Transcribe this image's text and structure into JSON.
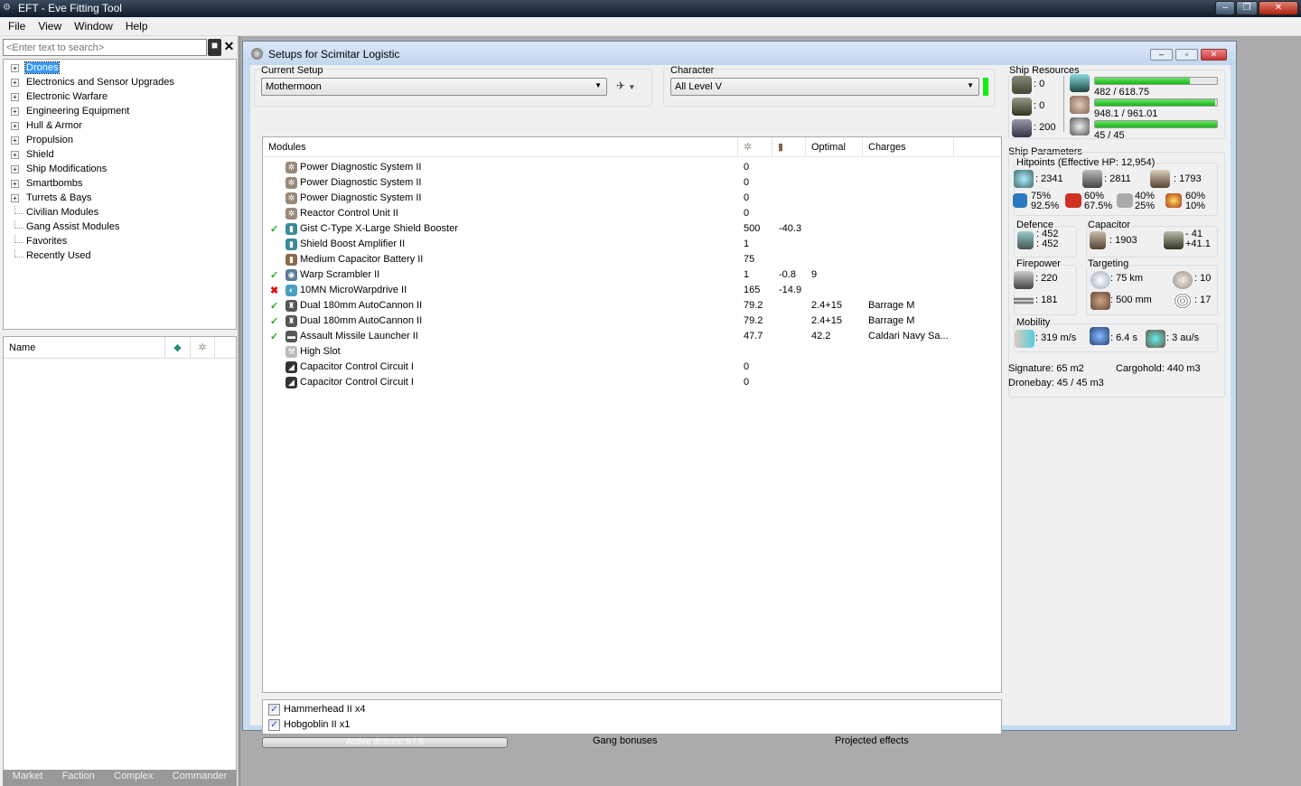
{
  "window": {
    "title": "EFT - Eve Fitting Tool",
    "min": "–",
    "max": "❐",
    "close": "✕"
  },
  "menu": [
    "File",
    "View",
    "Window",
    "Help"
  ],
  "search": {
    "placeholder": "<Enter text to search>"
  },
  "tree": [
    {
      "label": "Drones",
      "expandable": true,
      "selected": true
    },
    {
      "label": "Electronics and Sensor Upgrades",
      "expandable": true
    },
    {
      "label": "Electronic Warfare",
      "expandable": true
    },
    {
      "label": "Engineering Equipment",
      "expandable": true
    },
    {
      "label": "Hull & Armor",
      "expandable": true
    },
    {
      "label": "Propulsion",
      "expandable": true
    },
    {
      "label": "Shield",
      "expandable": true
    },
    {
      "label": "Ship Modifications",
      "expandable": true
    },
    {
      "label": "Smartbombs",
      "expandable": true
    },
    {
      "label": "Turrets & Bays",
      "expandable": true
    },
    {
      "label": "Civilian Modules",
      "expandable": false
    },
    {
      "label": "Gang Assist Modules",
      "expandable": false
    },
    {
      "label": "Favorites",
      "expandable": false
    },
    {
      "label": "Recently Used",
      "expandable": false
    }
  ],
  "namelist": {
    "header": "Name"
  },
  "bottom_tabs": [
    "Market",
    "Faction",
    "Complex",
    "Commander"
  ],
  "setup": {
    "title": "Setups for Scimitar Logistic",
    "current_setup_label": "Current Setup",
    "current_setup": "Mothermoon",
    "character_label": "Character",
    "character": "All Level V",
    "columns": {
      "modules": "Modules",
      "optimal": "Optimal",
      "charges": "Charges"
    },
    "modules": [
      {
        "state": "",
        "icon": "cpu",
        "color": "#9a8a7a",
        "name": "Power Diagnostic System II",
        "cpu": "0",
        "cap": "",
        "optimal": "",
        "charges": ""
      },
      {
        "state": "",
        "icon": "cpu",
        "color": "#9a8a7a",
        "name": "Power Diagnostic System II",
        "cpu": "0",
        "cap": "",
        "optimal": "",
        "charges": ""
      },
      {
        "state": "",
        "icon": "cpu",
        "color": "#9a8a7a",
        "name": "Power Diagnostic System II",
        "cpu": "0",
        "cap": "",
        "optimal": "",
        "charges": ""
      },
      {
        "state": "",
        "icon": "cpu",
        "color": "#9a8a7a",
        "name": "Reactor Control Unit II",
        "cpu": "0",
        "cap": "",
        "optimal": "",
        "charges": ""
      },
      {
        "state": "on",
        "icon": "shield",
        "color": "#3a8a9a",
        "name": "Gist C-Type X-Large Shield Booster",
        "cpu": "500",
        "cap": "-40.3",
        "optimal": "",
        "charges": ""
      },
      {
        "state": "",
        "icon": "shield",
        "color": "#3a8a9a",
        "name": "Shield Boost Amplifier II",
        "cpu": "1",
        "cap": "",
        "optimal": "",
        "charges": ""
      },
      {
        "state": "",
        "icon": "battery",
        "color": "#8a6a4a",
        "name": "Medium Capacitor Battery II",
        "cpu": "75",
        "cap": "",
        "optimal": "",
        "charges": ""
      },
      {
        "state": "on",
        "icon": "scrambler",
        "color": "#5a7a9a",
        "name": "Warp Scrambler II",
        "cpu": "1",
        "cap": "-0.8",
        "optimal": "9",
        "charges": ""
      },
      {
        "state": "off",
        "icon": "mwd",
        "color": "#4aa0c0",
        "name": "10MN MicroWarpdrive II",
        "cpu": "165",
        "cap": "-14.9",
        "optimal": "",
        "charges": ""
      },
      {
        "state": "on",
        "icon": "turret",
        "color": "#555",
        "name": "Dual 180mm AutoCannon II",
        "cpu": "79.2",
        "cap": "",
        "optimal": "2.4+15",
        "charges": "Barrage M"
      },
      {
        "state": "on",
        "icon": "turret",
        "color": "#555",
        "name": "Dual 180mm AutoCannon II",
        "cpu": "79.2",
        "cap": "",
        "optimal": "2.4+15",
        "charges": "Barrage M"
      },
      {
        "state": "on",
        "icon": "launcher",
        "color": "#555",
        "name": "Assault Missile Launcher II",
        "cpu": "47.7",
        "cap": "",
        "optimal": "42.2",
        "charges": "Caldari Navy Sa..."
      },
      {
        "state": "",
        "icon": "high-slot",
        "color": "#bbb",
        "name": "High Slot",
        "cpu": "",
        "cap": "",
        "optimal": "",
        "charges": ""
      },
      {
        "state": "",
        "icon": "rig",
        "color": "#333",
        "name": "Capacitor Control Circuit I",
        "cpu": "0",
        "cap": "",
        "optimal": "",
        "charges": ""
      },
      {
        "state": "",
        "icon": "rig",
        "color": "#333",
        "name": "Capacitor Control Circuit I",
        "cpu": "0",
        "cap": "",
        "optimal": "",
        "charges": ""
      }
    ],
    "drones": [
      {
        "name": "Hammerhead II x4",
        "checked": true
      },
      {
        "name": "Hobgoblin II x1",
        "checked": true
      }
    ],
    "active_drones": "Active drones: 5 / 5",
    "active_drones_fraction": 1.0,
    "gang_bonuses": "Gang bonuses",
    "projected_effects": "Projected effects"
  },
  "resources": {
    "title": "Ship Resources",
    "turret_hardpoints": ": 0",
    "launcher_hardpoints": ": 0",
    "calibration": ": 200",
    "cpu": "482 / 618.75",
    "cpu_fraction": 0.779,
    "powergrid": "948.1 / 961.01",
    "powergrid_fraction": 0.987,
    "drone_bandwidth": "45 / 45",
    "drone_bandwidth_fraction": 1.0
  },
  "params": {
    "title": "Ship Parameters",
    "hitpoints": "Hitpoints (Effective HP: 12,954)",
    "shield_hp": ": 2341",
    "armor_hp": ": 2811",
    "structure_hp": ": 1793",
    "em": [
      "75%",
      "92.5%"
    ],
    "thermal": [
      "60%",
      "67.5%"
    ],
    "kinetic": [
      "40%",
      "25%"
    ],
    "explosive": [
      "60%",
      "10%"
    ],
    "defence_label": "Defence",
    "defence": [
      ": 452",
      ": 452"
    ],
    "capacitor_label": "Capacitor",
    "capacitor": ": 1903",
    "cap_delta": [
      "- 41",
      "+41.1"
    ],
    "firepower_label": "Firepower",
    "dps": ": 220",
    "volley": ": 181",
    "targeting_label": "Targeting",
    "range": ": 75 km",
    "scan_res": ": 500 mm",
    "max_targets": ": 10",
    "sensor": ": 17",
    "mobility_label": "Mobility",
    "speed": ": 319 m/s",
    "align": ": 6.4 s",
    "warp": ": 3 au/s",
    "signature": "Signature: 65 m2",
    "cargohold": "Cargohold: 440 m3",
    "dronebay": "Dronebay: 45 / 45 m3"
  }
}
